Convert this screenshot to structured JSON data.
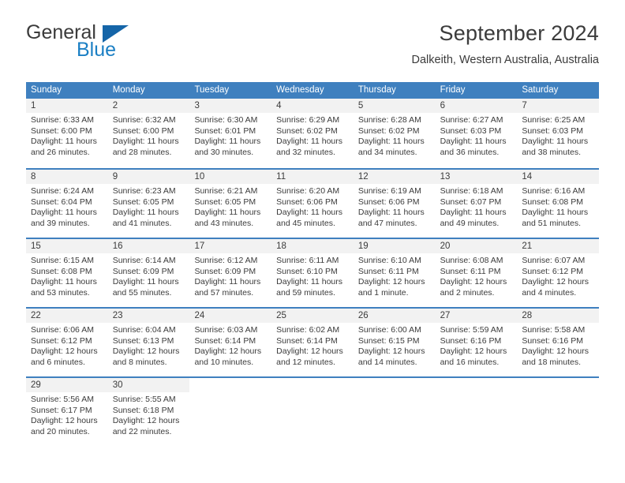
{
  "brand": {
    "name_part1": "General",
    "name_part2": "Blue",
    "icon": "sail-triangle-icon",
    "color_dark": "#3b3b3b",
    "color_blue": "#1b7fc4"
  },
  "header": {
    "title": "September 2024",
    "subtitle": "Dalkeith, Western Australia, Australia"
  },
  "theme": {
    "header_blue": "#3f80bf",
    "date_band_gray": "#f2f2f2",
    "text": "#3b3b3b"
  },
  "calendar": {
    "weekdays": [
      "Sunday",
      "Monday",
      "Tuesday",
      "Wednesday",
      "Thursday",
      "Friday",
      "Saturday"
    ],
    "weeks": [
      [
        {
          "day": "1",
          "sunrise": "Sunrise: 6:33 AM",
          "sunset": "Sunset: 6:00 PM",
          "daylight1": "Daylight: 11 hours",
          "daylight2": "and 26 minutes."
        },
        {
          "day": "2",
          "sunrise": "Sunrise: 6:32 AM",
          "sunset": "Sunset: 6:00 PM",
          "daylight1": "Daylight: 11 hours",
          "daylight2": "and 28 minutes."
        },
        {
          "day": "3",
          "sunrise": "Sunrise: 6:30 AM",
          "sunset": "Sunset: 6:01 PM",
          "daylight1": "Daylight: 11 hours",
          "daylight2": "and 30 minutes."
        },
        {
          "day": "4",
          "sunrise": "Sunrise: 6:29 AM",
          "sunset": "Sunset: 6:02 PM",
          "daylight1": "Daylight: 11 hours",
          "daylight2": "and 32 minutes."
        },
        {
          "day": "5",
          "sunrise": "Sunrise: 6:28 AM",
          "sunset": "Sunset: 6:02 PM",
          "daylight1": "Daylight: 11 hours",
          "daylight2": "and 34 minutes."
        },
        {
          "day": "6",
          "sunrise": "Sunrise: 6:27 AM",
          "sunset": "Sunset: 6:03 PM",
          "daylight1": "Daylight: 11 hours",
          "daylight2": "and 36 minutes."
        },
        {
          "day": "7",
          "sunrise": "Sunrise: 6:25 AM",
          "sunset": "Sunset: 6:03 PM",
          "daylight1": "Daylight: 11 hours",
          "daylight2": "and 38 minutes."
        }
      ],
      [
        {
          "day": "8",
          "sunrise": "Sunrise: 6:24 AM",
          "sunset": "Sunset: 6:04 PM",
          "daylight1": "Daylight: 11 hours",
          "daylight2": "and 39 minutes."
        },
        {
          "day": "9",
          "sunrise": "Sunrise: 6:23 AM",
          "sunset": "Sunset: 6:05 PM",
          "daylight1": "Daylight: 11 hours",
          "daylight2": "and 41 minutes."
        },
        {
          "day": "10",
          "sunrise": "Sunrise: 6:21 AM",
          "sunset": "Sunset: 6:05 PM",
          "daylight1": "Daylight: 11 hours",
          "daylight2": "and 43 minutes."
        },
        {
          "day": "11",
          "sunrise": "Sunrise: 6:20 AM",
          "sunset": "Sunset: 6:06 PM",
          "daylight1": "Daylight: 11 hours",
          "daylight2": "and 45 minutes."
        },
        {
          "day": "12",
          "sunrise": "Sunrise: 6:19 AM",
          "sunset": "Sunset: 6:06 PM",
          "daylight1": "Daylight: 11 hours",
          "daylight2": "and 47 minutes."
        },
        {
          "day": "13",
          "sunrise": "Sunrise: 6:18 AM",
          "sunset": "Sunset: 6:07 PM",
          "daylight1": "Daylight: 11 hours",
          "daylight2": "and 49 minutes."
        },
        {
          "day": "14",
          "sunrise": "Sunrise: 6:16 AM",
          "sunset": "Sunset: 6:08 PM",
          "daylight1": "Daylight: 11 hours",
          "daylight2": "and 51 minutes."
        }
      ],
      [
        {
          "day": "15",
          "sunrise": "Sunrise: 6:15 AM",
          "sunset": "Sunset: 6:08 PM",
          "daylight1": "Daylight: 11 hours",
          "daylight2": "and 53 minutes."
        },
        {
          "day": "16",
          "sunrise": "Sunrise: 6:14 AM",
          "sunset": "Sunset: 6:09 PM",
          "daylight1": "Daylight: 11 hours",
          "daylight2": "and 55 minutes."
        },
        {
          "day": "17",
          "sunrise": "Sunrise: 6:12 AM",
          "sunset": "Sunset: 6:09 PM",
          "daylight1": "Daylight: 11 hours",
          "daylight2": "and 57 minutes."
        },
        {
          "day": "18",
          "sunrise": "Sunrise: 6:11 AM",
          "sunset": "Sunset: 6:10 PM",
          "daylight1": "Daylight: 11 hours",
          "daylight2": "and 59 minutes."
        },
        {
          "day": "19",
          "sunrise": "Sunrise: 6:10 AM",
          "sunset": "Sunset: 6:11 PM",
          "daylight1": "Daylight: 12 hours",
          "daylight2": "and 1 minute."
        },
        {
          "day": "20",
          "sunrise": "Sunrise: 6:08 AM",
          "sunset": "Sunset: 6:11 PM",
          "daylight1": "Daylight: 12 hours",
          "daylight2": "and 2 minutes."
        },
        {
          "day": "21",
          "sunrise": "Sunrise: 6:07 AM",
          "sunset": "Sunset: 6:12 PM",
          "daylight1": "Daylight: 12 hours",
          "daylight2": "and 4 minutes."
        }
      ],
      [
        {
          "day": "22",
          "sunrise": "Sunrise: 6:06 AM",
          "sunset": "Sunset: 6:12 PM",
          "daylight1": "Daylight: 12 hours",
          "daylight2": "and 6 minutes."
        },
        {
          "day": "23",
          "sunrise": "Sunrise: 6:04 AM",
          "sunset": "Sunset: 6:13 PM",
          "daylight1": "Daylight: 12 hours",
          "daylight2": "and 8 minutes."
        },
        {
          "day": "24",
          "sunrise": "Sunrise: 6:03 AM",
          "sunset": "Sunset: 6:14 PM",
          "daylight1": "Daylight: 12 hours",
          "daylight2": "and 10 minutes."
        },
        {
          "day": "25",
          "sunrise": "Sunrise: 6:02 AM",
          "sunset": "Sunset: 6:14 PM",
          "daylight1": "Daylight: 12 hours",
          "daylight2": "and 12 minutes."
        },
        {
          "day": "26",
          "sunrise": "Sunrise: 6:00 AM",
          "sunset": "Sunset: 6:15 PM",
          "daylight1": "Daylight: 12 hours",
          "daylight2": "and 14 minutes."
        },
        {
          "day": "27",
          "sunrise": "Sunrise: 5:59 AM",
          "sunset": "Sunset: 6:16 PM",
          "daylight1": "Daylight: 12 hours",
          "daylight2": "and 16 minutes."
        },
        {
          "day": "28",
          "sunrise": "Sunrise: 5:58 AM",
          "sunset": "Sunset: 6:16 PM",
          "daylight1": "Daylight: 12 hours",
          "daylight2": "and 18 minutes."
        }
      ],
      [
        {
          "day": "29",
          "sunrise": "Sunrise: 5:56 AM",
          "sunset": "Sunset: 6:17 PM",
          "daylight1": "Daylight: 12 hours",
          "daylight2": "and 20 minutes."
        },
        {
          "day": "30",
          "sunrise": "Sunrise: 5:55 AM",
          "sunset": "Sunset: 6:18 PM",
          "daylight1": "Daylight: 12 hours",
          "daylight2": "and 22 minutes."
        },
        {
          "day": "",
          "sunrise": "",
          "sunset": "",
          "daylight1": "",
          "daylight2": ""
        },
        {
          "day": "",
          "sunrise": "",
          "sunset": "",
          "daylight1": "",
          "daylight2": ""
        },
        {
          "day": "",
          "sunrise": "",
          "sunset": "",
          "daylight1": "",
          "daylight2": ""
        },
        {
          "day": "",
          "sunrise": "",
          "sunset": "",
          "daylight1": "",
          "daylight2": ""
        },
        {
          "day": "",
          "sunrise": "",
          "sunset": "",
          "daylight1": "",
          "daylight2": ""
        }
      ]
    ]
  }
}
